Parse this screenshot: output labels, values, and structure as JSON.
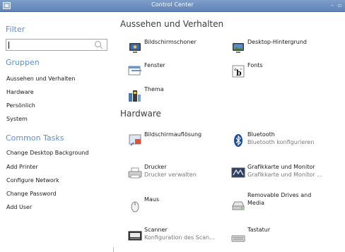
{
  "window": {
    "title": "Control Center",
    "minimize": "–",
    "maximize": "▫"
  },
  "sidebar": {
    "filter_heading": "Filter",
    "search": {
      "value": "",
      "placeholder": ""
    },
    "groups_heading": "Gruppen",
    "groups": [
      "Aussehen und Verhalten",
      "Hardware",
      "Persönlich",
      "System"
    ],
    "tasks_heading": "Common Tasks",
    "tasks": [
      "Change Desktop Background",
      "Add Printer",
      "Configure Network",
      "Change Password",
      "Add User"
    ]
  },
  "main": {
    "appearance": {
      "heading": "Aussehen und Verhalten",
      "items": [
        {
          "label": "Bildschirmschoner",
          "icon": "screensaver-icon"
        },
        {
          "label": "Desktop-Hintergrund",
          "icon": "desktop-background-icon"
        },
        {
          "label": "Fenster",
          "icon": "window-icon"
        },
        {
          "label": "Fonts",
          "icon": "fonts-icon"
        },
        {
          "label": "Thema",
          "icon": "theme-icon"
        }
      ]
    },
    "hardware": {
      "heading": "Hardware",
      "items": [
        {
          "label": "Bildschirmauflösung",
          "sub": "",
          "icon": "display-resolution-icon"
        },
        {
          "label": "Bluetooth",
          "sub": "Bluetooth konfigurieren",
          "icon": "bluetooth-icon"
        },
        {
          "label": "Drucker",
          "sub": "Drucker verwalten",
          "icon": "printer-icon"
        },
        {
          "label": "Grafikkarte und Monitor",
          "sub": "Grafikkarte und Monitor ...",
          "icon": "graphics-card-icon"
        },
        {
          "label": "Maus",
          "sub": "",
          "icon": "mouse-icon"
        },
        {
          "label": "Removable Drives and",
          "label2": "Media",
          "icon": "removable-drive-icon"
        },
        {
          "label": "Scanner",
          "sub": "Konfiguration des Scan...",
          "icon": "scanner-icon"
        },
        {
          "label": "Tastatur",
          "sub": "",
          "icon": "keyboard-icon"
        }
      ]
    }
  }
}
